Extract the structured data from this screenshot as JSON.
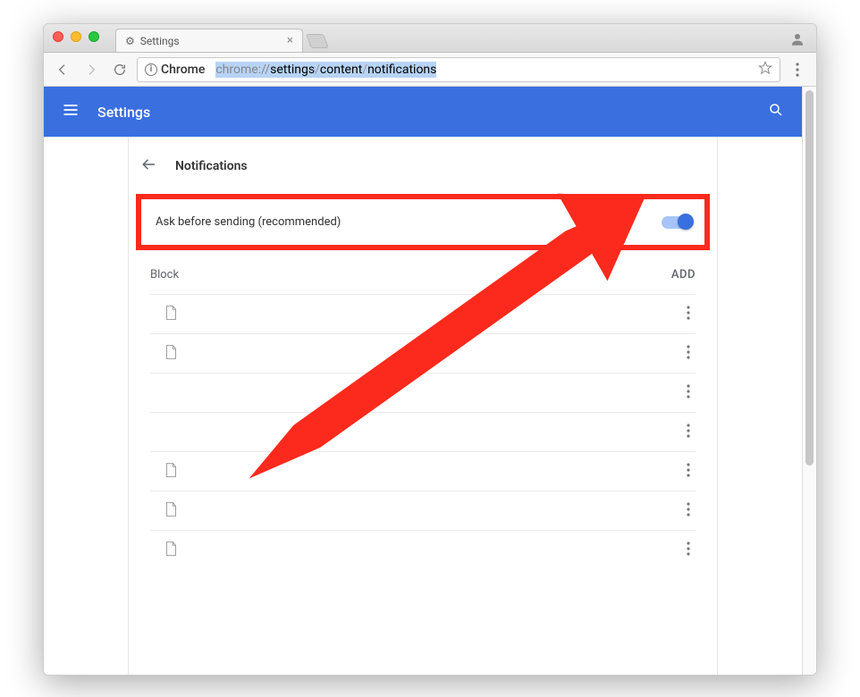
{
  "tab": {
    "title": "Settings"
  },
  "omnibox": {
    "scheme_label": "Chrome",
    "url_prefix": "chrome://",
    "seg1": "settings",
    "seg2": "content",
    "seg3": "notifications"
  },
  "header": {
    "title": "Settings"
  },
  "section": {
    "title": "Notifications"
  },
  "toggle_row": {
    "label": "Ask before sending (recommended)"
  },
  "block_section": {
    "label": "Block",
    "add_label": "ADD"
  },
  "block_items": [
    {
      "icon": true
    },
    {
      "icon": true
    },
    {
      "icon": false
    },
    {
      "icon": false
    },
    {
      "icon": true
    },
    {
      "icon": true
    },
    {
      "icon": true
    }
  ]
}
